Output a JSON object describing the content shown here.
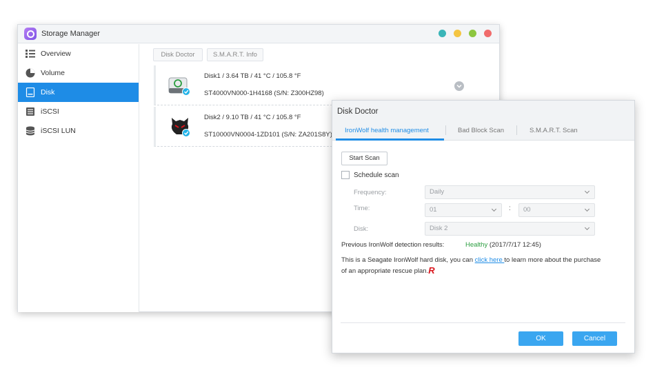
{
  "storage_manager": {
    "title": "Storage Manager",
    "window_controls": [
      {
        "name": "dot-teal",
        "color": "#3ab5b8"
      },
      {
        "name": "dot-yellow",
        "color": "#f4c542"
      },
      {
        "name": "dot-green",
        "color": "#8dc63f"
      },
      {
        "name": "dot-red",
        "color": "#f06b6b"
      }
    ],
    "sidebar": {
      "items": [
        {
          "label": "Overview",
          "icon": "overview-icon"
        },
        {
          "label": "Volume",
          "icon": "volume-icon"
        },
        {
          "label": "Disk",
          "icon": "disk-icon",
          "active": true
        },
        {
          "label": "iSCSI",
          "icon": "iscsi-icon"
        },
        {
          "label": "iSCSI LUN",
          "icon": "iscsi-lun-icon"
        }
      ]
    },
    "main": {
      "tabs": [
        "Disk Doctor",
        "S.M.A.R.T. Info"
      ],
      "disks": [
        {
          "line1": "Disk1 / 3.64 TB / 41 °C / 105.8 °F",
          "line2": "ST4000VN000-1H4168 (S/N: Z300HZ98)",
          "icon": "seagate-disk-icon"
        },
        {
          "line1": "Disk2 / 9.10 TB / 41 °C / 105.8 °F",
          "line2": "ST10000VN0004-1ZD101 (S/N: ZA201S8Y)",
          "icon": "ironwolf-disk-icon"
        }
      ]
    }
  },
  "disk_doctor": {
    "title": "Disk Doctor",
    "tabs": [
      "IronWolf health management",
      "Bad Block Scan",
      "S.M.A.R.T. Scan"
    ],
    "start_scan_label": "Start Scan",
    "schedule_scan_label": "Schedule scan",
    "schedule_checked": false,
    "frequency": {
      "label": "Frequency:",
      "value": "Daily"
    },
    "time": {
      "label": "Time:",
      "hour": "01",
      "minute": "00",
      "separator": ":"
    },
    "disk": {
      "label": "Disk:",
      "value": "Disk 2"
    },
    "previous_results": {
      "label": "Previous IronWolf detection results:",
      "status": "Healthy",
      "date": "(2017/7/17 12:45)"
    },
    "info": {
      "before_link": "This is a Seagate IronWolf hard disk, you can ",
      "link_text": "click here ",
      "after_link": "to learn more about the purchase of an appropriate rescue plan."
    },
    "rescue_logo_text": "R",
    "ok_label": "OK",
    "cancel_label": "Cancel",
    "colors": {
      "accent": "#1e8ce6",
      "button": "#3aa6f0",
      "healthy": "#2a9d3f"
    }
  }
}
